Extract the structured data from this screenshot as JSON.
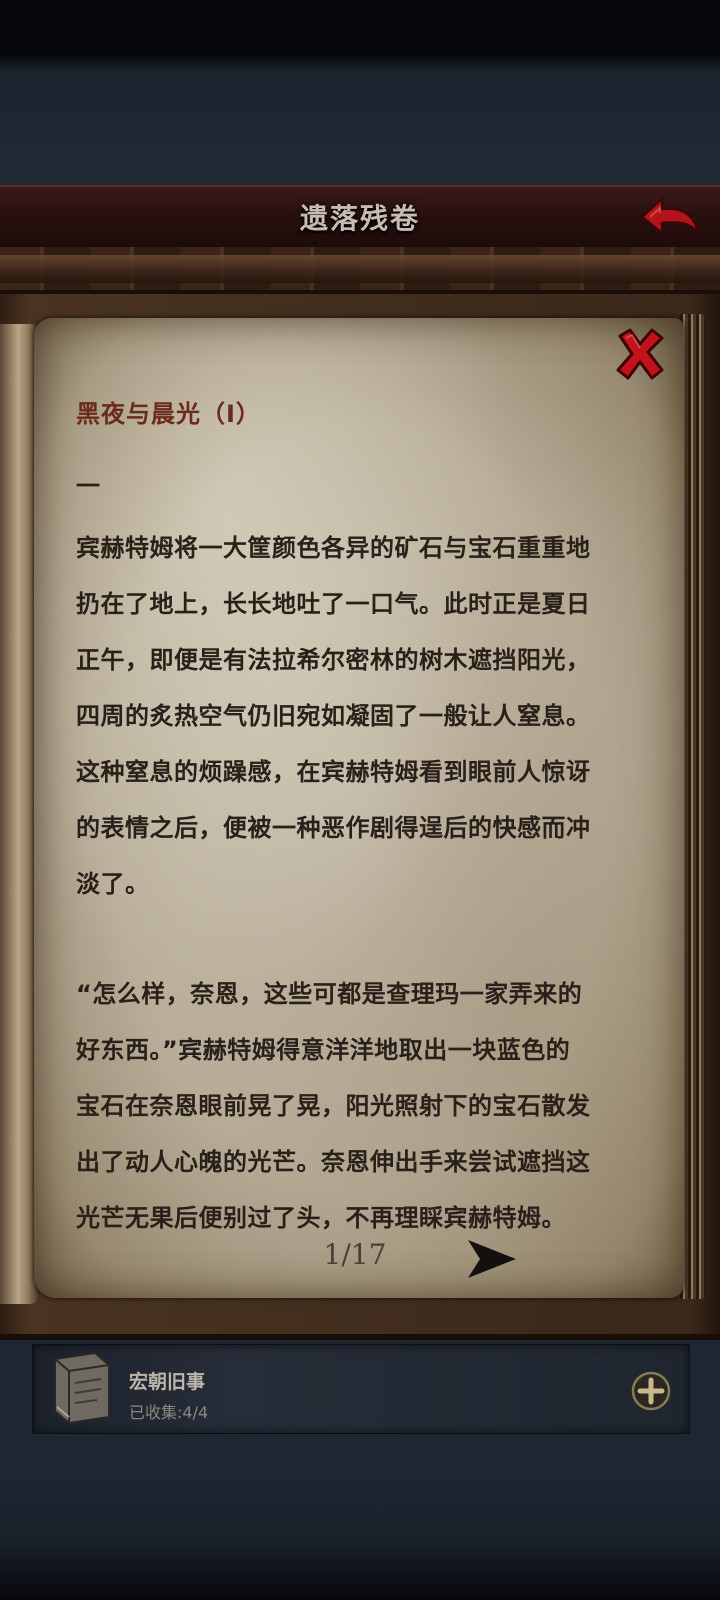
{
  "header": {
    "title": "遗落残卷",
    "back_icon": "back-arrow-icon"
  },
  "book": {
    "close_icon": "close-icon",
    "chapter_title": "黑夜与晨光（Ⅰ）",
    "section_mark": "一",
    "paragraph1": [
      "宾赫特姆将一大筐颜色各异的矿石与宝石重重地",
      "扔在了地上，长长地吐了一口气。此时正是夏日",
      "正午，即便是有法拉希尔密林的树木遮挡阳光，",
      "四周的炙热空气仍旧宛如凝固了一般让人窒息。",
      "这种窒息的烦躁感，在宾赫特姆看到眼前人惊讶",
      "的表情之后，便被一种恶作剧得逞后的快感而冲",
      "淡了。"
    ],
    "paragraph2": [
      "“怎么样，奈恩，这些可都是查理玛一家弄来的",
      "好东西。”宾赫特姆得意洋洋地取出一块蓝色的",
      "宝石在奈恩眼前晃了晃，阳光照射下的宝石散发",
      "出了动人心魄的光芒。奈恩伸出手来尝试遮挡这",
      "光芒无果后便别过了头，不再理睬宾赫特姆。"
    ],
    "page_indicator": "1/17",
    "next_icon": "next-page-arrow-icon"
  },
  "collection": {
    "icon": "book-icon",
    "name": "宏朝旧事",
    "count_label": "已收集:4/4",
    "add_icon": "plus-icon"
  },
  "colors": {
    "title_red": "#6b2a1c",
    "body_text": "#2a201a",
    "close_red": "#c4121a"
  }
}
